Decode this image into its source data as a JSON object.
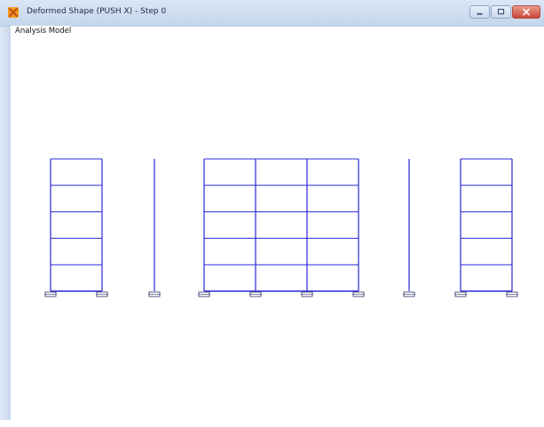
{
  "window": {
    "title": "Deformed Shape (PUSH X) - Step 0",
    "app_icon": "sap-app-icon",
    "controls": [
      {
        "name": "minimize-button",
        "icon": "minimize-icon"
      },
      {
        "name": "maximize-button",
        "icon": "maximize-icon"
      },
      {
        "name": "close-button",
        "icon": "close-icon"
      }
    ]
  },
  "view": {
    "label": "Analysis Model"
  },
  "colors": {
    "frame_line": "#2a2ad8",
    "support": "#333366",
    "titlebar": "#c4d6ec",
    "close_button": "#c9473a"
  },
  "model": {
    "frames": [
      {
        "name": "left-frame",
        "bays": 1,
        "stories": 5
      },
      {
        "name": "left-column",
        "bays": 0,
        "stories": 5
      },
      {
        "name": "center-frame",
        "bays": 3,
        "stories": 5
      },
      {
        "name": "right-column",
        "bays": 0,
        "stories": 5
      },
      {
        "name": "right-frame",
        "bays": 1,
        "stories": 5
      }
    ]
  }
}
